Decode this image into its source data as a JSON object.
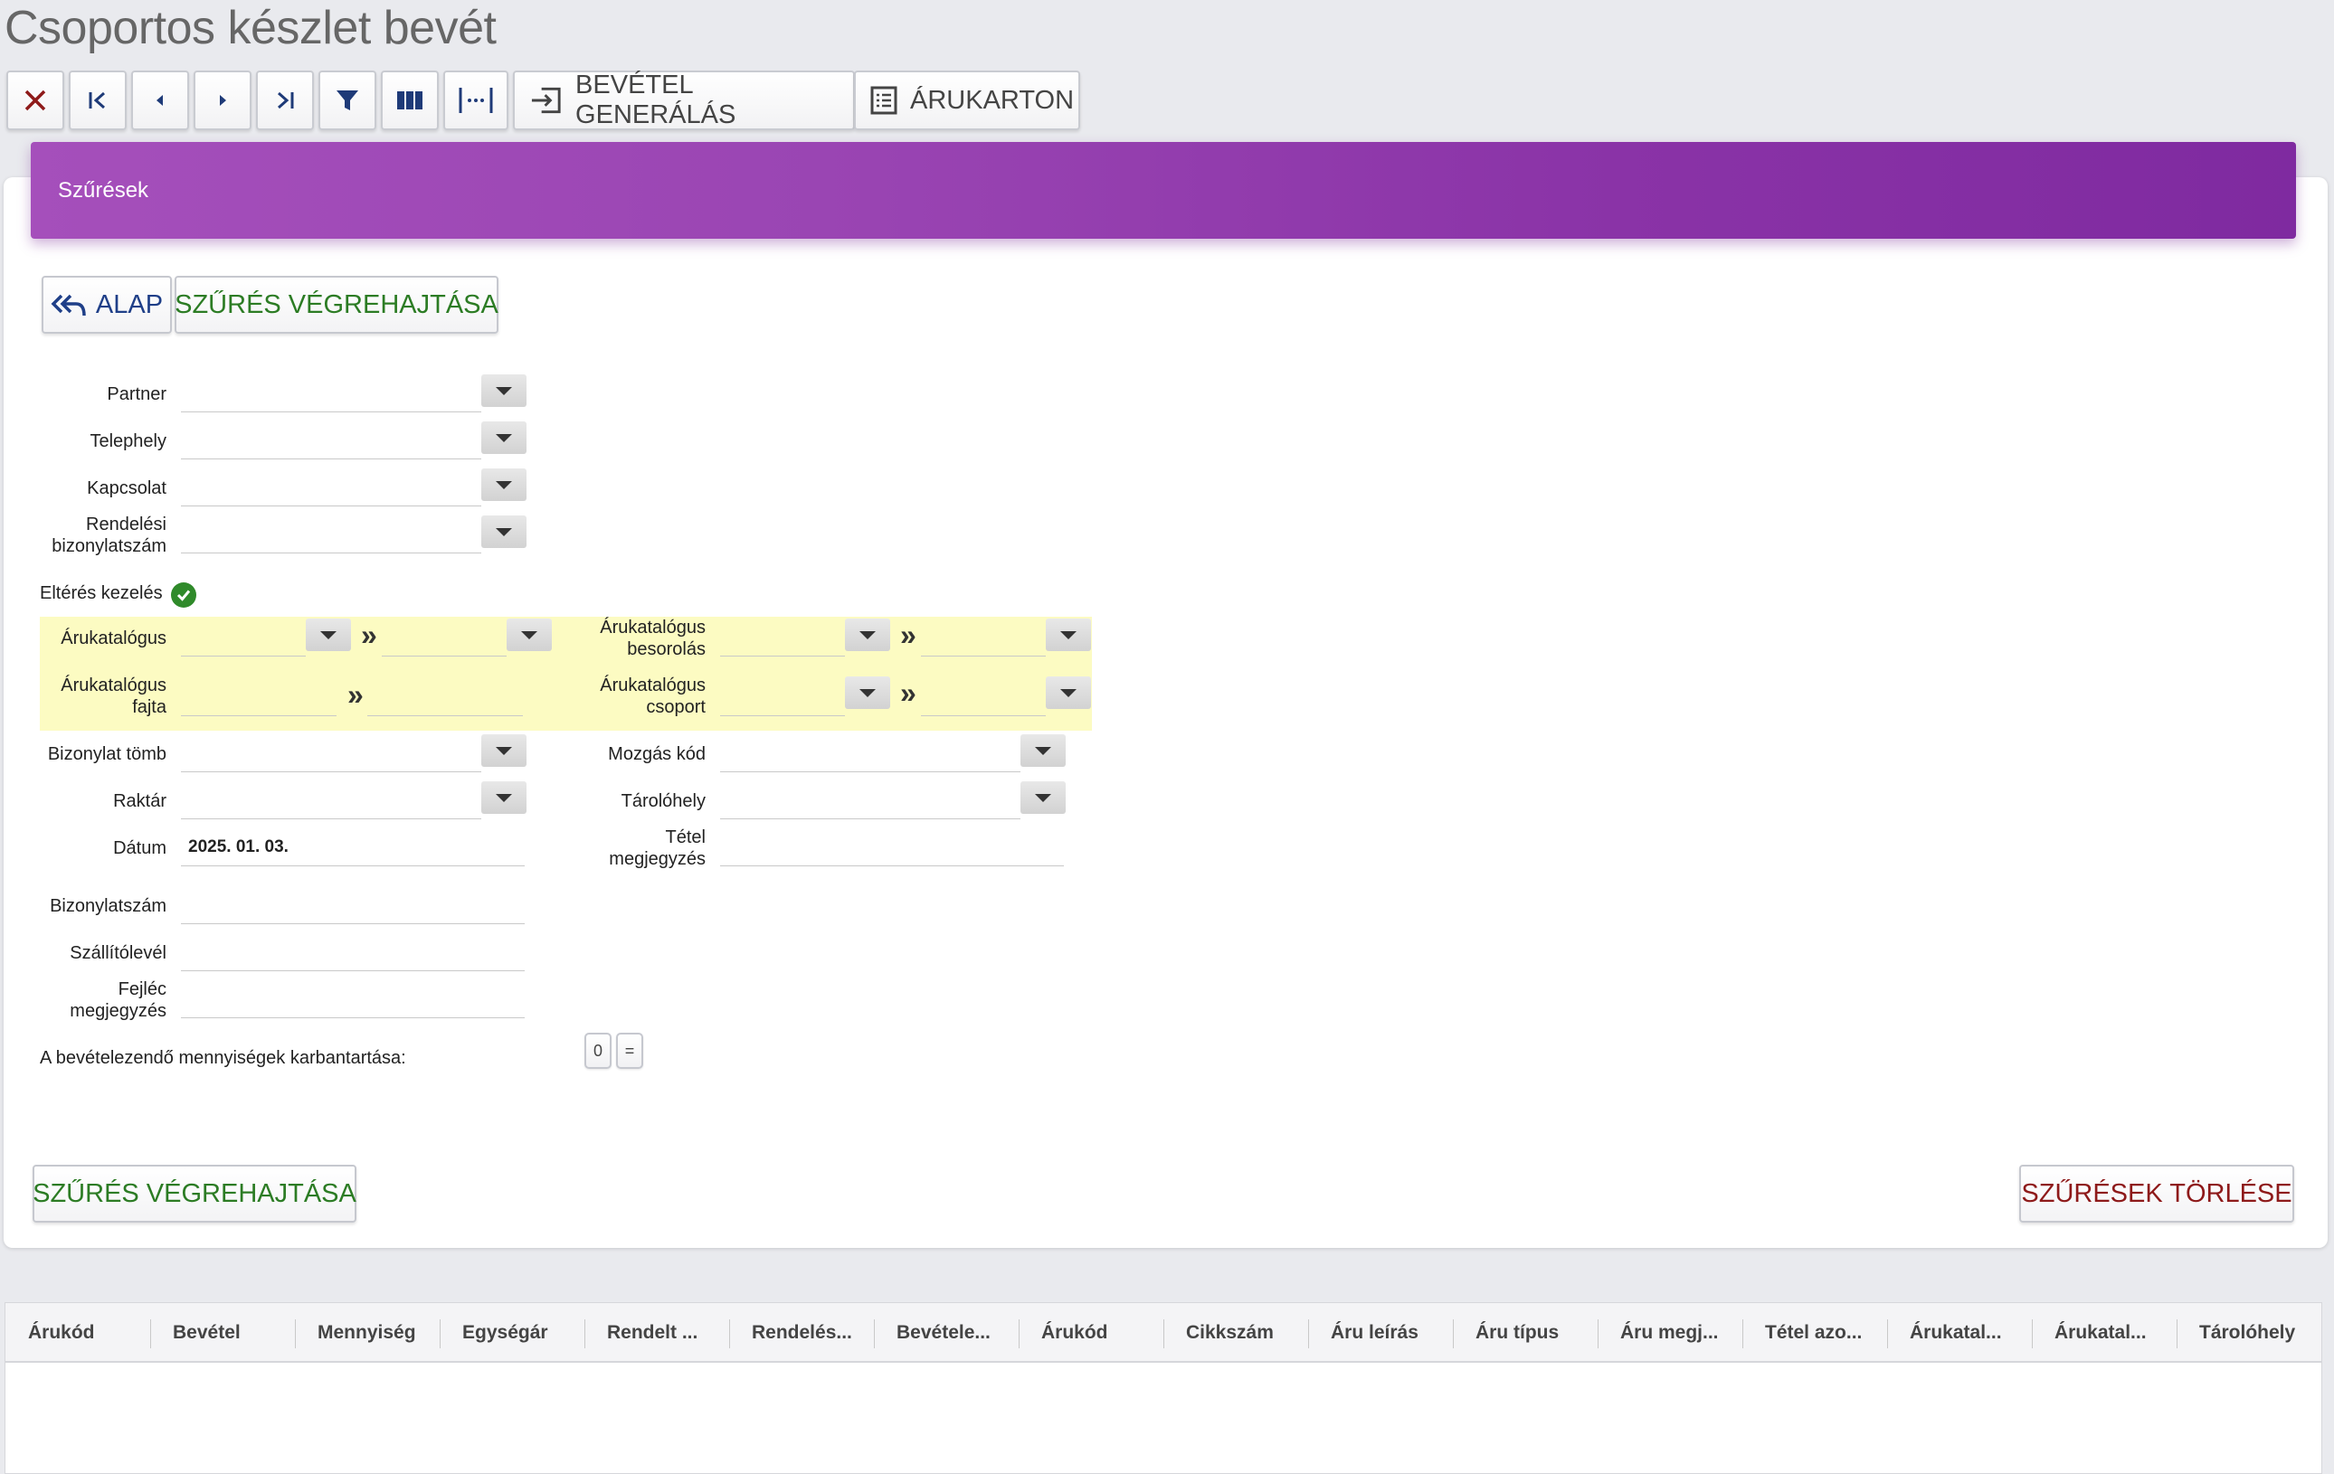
{
  "page": {
    "title": "Csoportos készlet bevét"
  },
  "toolbar": {
    "close": "close-icon",
    "first": "first-icon",
    "prev": "prev-icon",
    "next": "next-icon",
    "last": "last-icon",
    "filter": "filter-icon",
    "columns": "columns-icon",
    "fit": "fit-width-icon",
    "generate_label": "BEVÉTEL GENERÁLÁS",
    "card_label": "ÁRUKARTON"
  },
  "panel": {
    "header": "Szűrések",
    "base_label": "ALAP",
    "execute_label": "SZŰRÉS VÉGREHAJTÁSA",
    "bottom_execute_label": "SZŰRÉS VÉGREHAJTÁSA",
    "clear_label": "SZŰRÉSEK TÖRLÉSE"
  },
  "form": {
    "partner": "Partner",
    "telephely": "Telephely",
    "kapcsolat": "Kapcsolat",
    "rendelesi_1": "Rendelési",
    "rendelesi_2": "bizonylatszám",
    "elteres": "Eltérés kezelés",
    "arukatalogus": "Árukatalógus",
    "besorolas_1": "Árukatalógus",
    "besorolas_2": "besorolás",
    "fajta_1": "Árukatalógus",
    "fajta_2": "fajta",
    "csoport_1": "Árukatalógus",
    "csoport_2": "csoport",
    "bizonylat_tomb": "Bizonylat tömb",
    "mozgas_kod": "Mozgás kód",
    "raktar": "Raktár",
    "tarolohely": "Tárolóhely",
    "datum": "Dátum",
    "datum_value": "2025. 01. 03.",
    "tetel_1": "Tétel",
    "tetel_2": "megjegyzés",
    "bizonylatszam": "Bizonylatszám",
    "szallitolevel": "Szállítólevél",
    "fejlec_1": "Fejléc",
    "fejlec_2": "megjegyzés",
    "karbantartas": "A bevételezendő mennyiségek karbantartása:",
    "mini_zero": "0",
    "mini_eq": "="
  },
  "grid": {
    "columns": [
      "Árukód",
      "Bevétel",
      "Mennyiség",
      "Egységár",
      "Rendelt ...",
      "Rendelés...",
      "Bevétele...",
      "Árukód",
      "Cikkszám",
      "Áru leírás",
      "Áru típus",
      "Áru megj...",
      "Tétel azo...",
      "Árukatal...",
      "Árukatal...",
      "Tárolóhely"
    ]
  }
}
